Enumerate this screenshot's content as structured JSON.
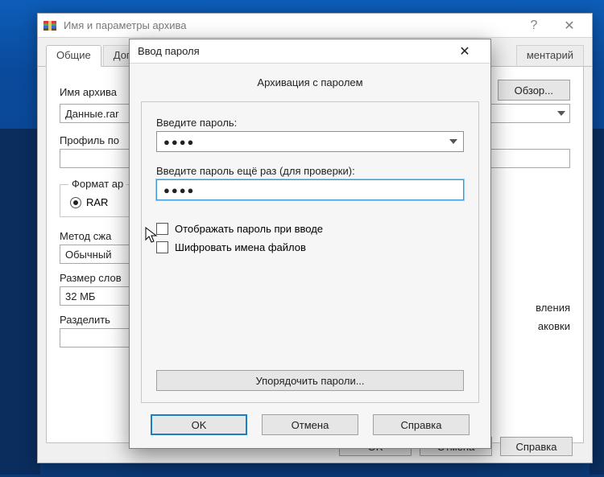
{
  "back_window": {
    "title": "Имя и параметры архива",
    "tabs": {
      "general": "Общие",
      "additional": "Доп",
      "comment": "ментарий"
    },
    "archive_name_label": "Имя архива",
    "archive_name_value": "Данные.rar",
    "browse_button": "Обзор...",
    "profile_label": "Профиль по",
    "format_group": "Формат ар",
    "format_rar": "RAR",
    "method_label": "Метод сжа",
    "method_value": "Обычный",
    "dict_label": "Размер слов",
    "dict_value": "32 МБ",
    "split_label": "Разделить",
    "right_text1": "вления",
    "right_text2": "аковки",
    "ok": "OK",
    "cancel": "Отмена",
    "help": "Справка"
  },
  "modal": {
    "title": "Ввод пароля",
    "heading": "Архивация с паролем",
    "pw1_label": "Введите пароль:",
    "pw1_value": "●●●●",
    "pw2_label": "Введите пароль ещё раз (для проверки):",
    "pw2_value": "●●●●",
    "show_pw": "Отображать пароль при вводе",
    "encrypt_names": "Шифровать имена файлов",
    "organize": "Упорядочить пароли...",
    "ok": "OK",
    "cancel": "Отмена",
    "help": "Справка"
  }
}
